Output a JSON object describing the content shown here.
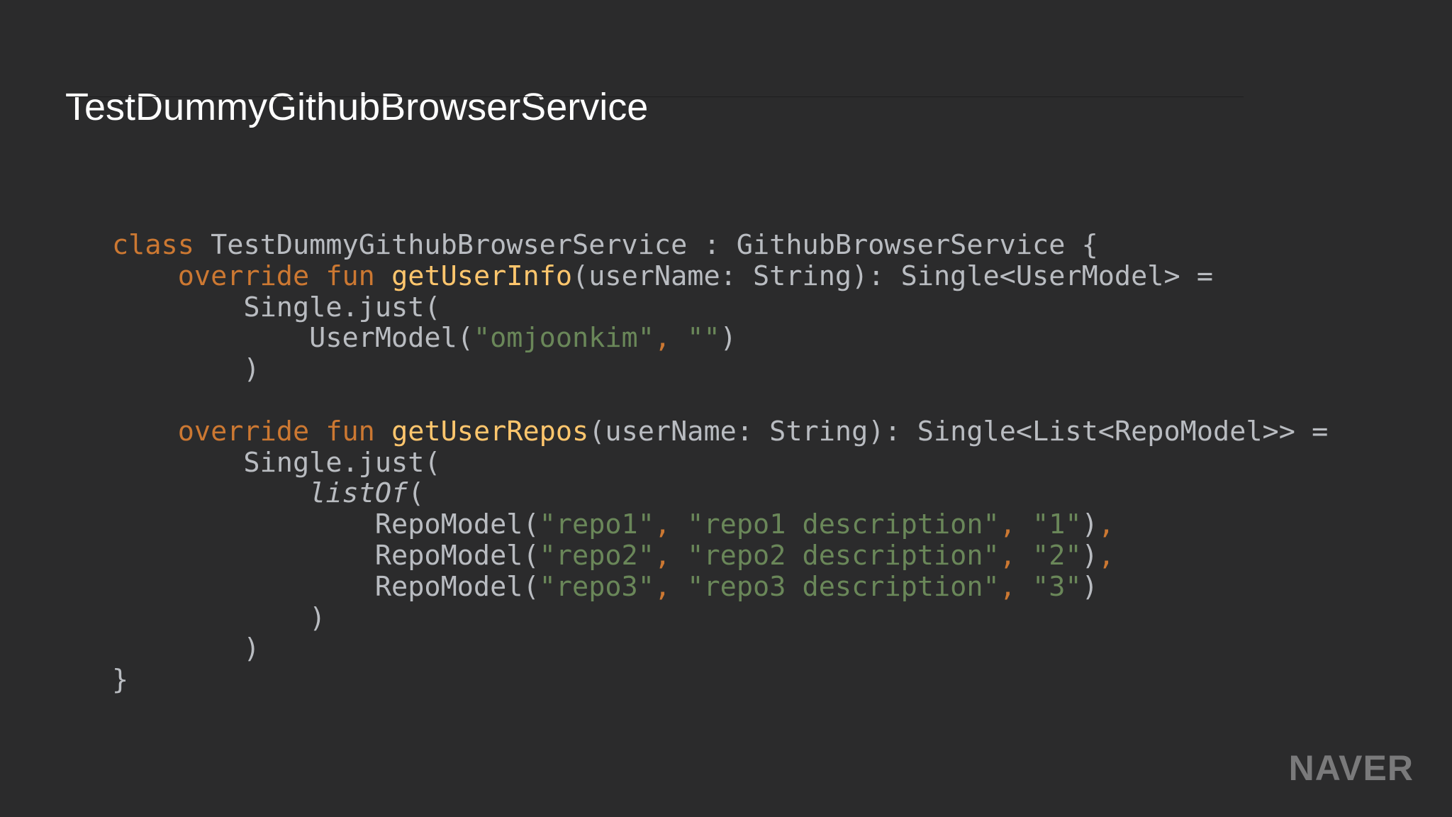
{
  "slide": {
    "title": "TestDummyGithubBrowserService",
    "logo": "NAVER"
  },
  "code": {
    "lines": [
      {
        "tokens": [
          {
            "t": "class",
            "c": "kw"
          },
          {
            "t": " TestDummyGithubBrowserService : GithubBrowserService {",
            "c": "pl"
          }
        ]
      },
      {
        "tokens": [
          {
            "t": "    ",
            "c": "pl"
          },
          {
            "t": "override fun",
            "c": "kw"
          },
          {
            "t": " ",
            "c": "pl"
          },
          {
            "t": "getUserInfo",
            "c": "fn"
          },
          {
            "t": "(userName: String): Single<UserModel> =",
            "c": "pl"
          }
        ]
      },
      {
        "tokens": [
          {
            "t": "        Single.just(",
            "c": "pl"
          }
        ]
      },
      {
        "tokens": [
          {
            "t": "            UserModel(",
            "c": "pl"
          },
          {
            "t": "\"omjoonkim\"",
            "c": "str"
          },
          {
            "t": ",",
            "c": "punc"
          },
          {
            "t": " ",
            "c": "pl"
          },
          {
            "t": "\"\"",
            "c": "str"
          },
          {
            "t": ")",
            "c": "pl"
          }
        ]
      },
      {
        "tokens": [
          {
            "t": "        )",
            "c": "pl"
          }
        ]
      },
      {
        "tokens": []
      },
      {
        "tokens": [
          {
            "t": "    ",
            "c": "pl"
          },
          {
            "t": "override fun",
            "c": "kw"
          },
          {
            "t": " ",
            "c": "pl"
          },
          {
            "t": "getUserRepos",
            "c": "fn"
          },
          {
            "t": "(userName: String): Single<List<RepoModel>> =",
            "c": "pl"
          }
        ]
      },
      {
        "tokens": [
          {
            "t": "        Single.just(",
            "c": "pl"
          }
        ]
      },
      {
        "tokens": [
          {
            "t": "            ",
            "c": "pl"
          },
          {
            "t": "listOf",
            "c": "it"
          },
          {
            "t": "(",
            "c": "pl"
          }
        ]
      },
      {
        "tokens": [
          {
            "t": "                RepoModel(",
            "c": "pl"
          },
          {
            "t": "\"repo1\"",
            "c": "str"
          },
          {
            "t": ",",
            "c": "punc"
          },
          {
            "t": " ",
            "c": "pl"
          },
          {
            "t": "\"repo1 description\"",
            "c": "str"
          },
          {
            "t": ",",
            "c": "punc"
          },
          {
            "t": " ",
            "c": "pl"
          },
          {
            "t": "\"1\"",
            "c": "str"
          },
          {
            "t": ")",
            "c": "pl"
          },
          {
            "t": ",",
            "c": "punc"
          }
        ]
      },
      {
        "tokens": [
          {
            "t": "                RepoModel(",
            "c": "pl"
          },
          {
            "t": "\"repo2\"",
            "c": "str"
          },
          {
            "t": ",",
            "c": "punc"
          },
          {
            "t": " ",
            "c": "pl"
          },
          {
            "t": "\"repo2 description\"",
            "c": "str"
          },
          {
            "t": ",",
            "c": "punc"
          },
          {
            "t": " ",
            "c": "pl"
          },
          {
            "t": "\"2\"",
            "c": "str"
          },
          {
            "t": ")",
            "c": "pl"
          },
          {
            "t": ",",
            "c": "punc"
          }
        ]
      },
      {
        "tokens": [
          {
            "t": "                RepoModel(",
            "c": "pl"
          },
          {
            "t": "\"repo3\"",
            "c": "str"
          },
          {
            "t": ",",
            "c": "punc"
          },
          {
            "t": " ",
            "c": "pl"
          },
          {
            "t": "\"repo3 description\"",
            "c": "str"
          },
          {
            "t": ",",
            "c": "punc"
          },
          {
            "t": " ",
            "c": "pl"
          },
          {
            "t": "\"3\"",
            "c": "str"
          },
          {
            "t": ")",
            "c": "pl"
          }
        ]
      },
      {
        "tokens": [
          {
            "t": "            )",
            "c": "pl"
          }
        ]
      },
      {
        "tokens": [
          {
            "t": "        )",
            "c": "pl"
          }
        ]
      },
      {
        "tokens": [
          {
            "t": "}",
            "c": "pl"
          }
        ]
      }
    ]
  }
}
